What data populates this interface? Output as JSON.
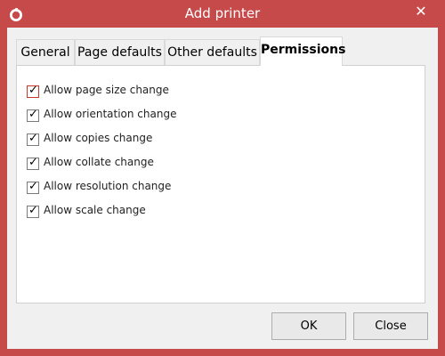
{
  "window": {
    "title": "Add printer"
  },
  "tabs": [
    {
      "label": "General"
    },
    {
      "label": "Page defaults"
    },
    {
      "label": "Other defaults"
    },
    {
      "label": "Permissions"
    }
  ],
  "permissions": [
    {
      "label": "Allow page size change",
      "checked": true
    },
    {
      "label": "Allow orientation change",
      "checked": true
    },
    {
      "label": "Allow copies change",
      "checked": true
    },
    {
      "label": "Allow collate change",
      "checked": true
    },
    {
      "label": "Allow resolution change",
      "checked": true
    },
    {
      "label": "Allow scale change",
      "checked": true
    }
  ],
  "buttons": {
    "ok": "OK",
    "close": "Close"
  },
  "colors": {
    "frame": "#c74a4a",
    "client": "#f0f0f0",
    "panel": "#ffffff"
  },
  "icons": {
    "app": "app-logo-icon",
    "close": "close-icon",
    "check": "checkmark-icon"
  }
}
